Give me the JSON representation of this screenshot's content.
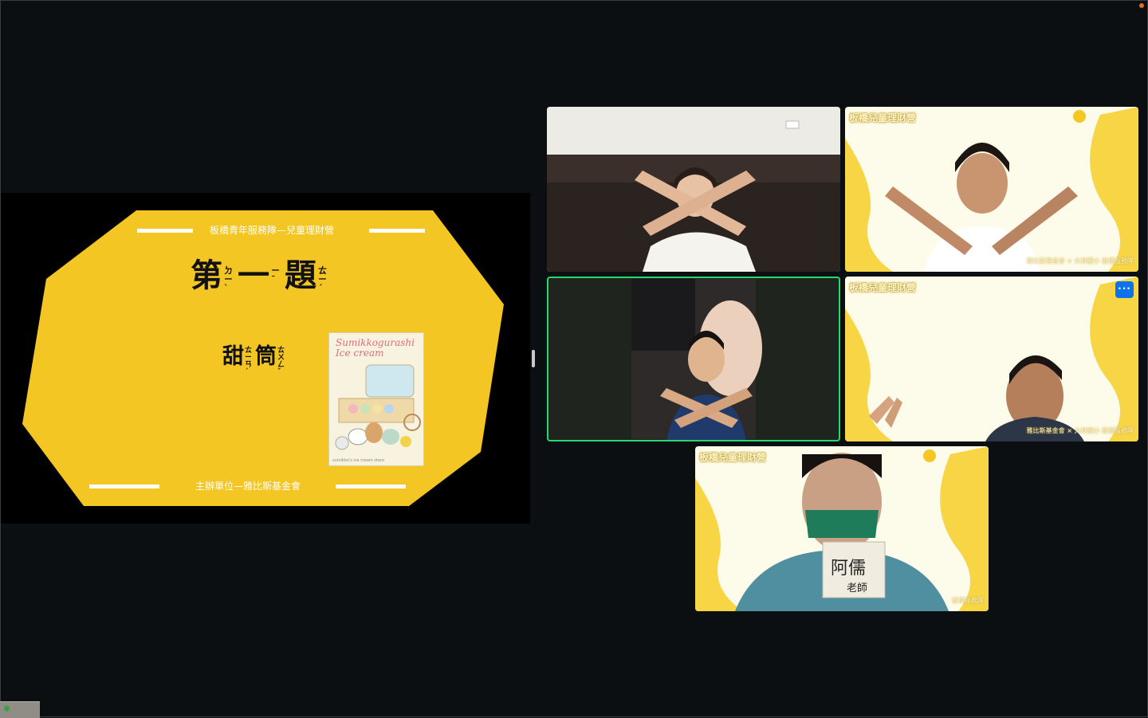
{
  "slide": {
    "header": "板橋青年服務隊—兒童理財營",
    "title_chars": [
      "第",
      "一",
      "題"
    ],
    "title_zhuyin": [
      [
        "ㄉ",
        "ㄧ",
        "ˋ"
      ],
      [
        "ㄧ",
        "ˉ"
      ],
      [
        "ㄊ",
        "ㄧ",
        "ˊ"
      ]
    ],
    "answer_chars": [
      "甜",
      "筒"
    ],
    "answer_zhuyin": [
      [
        "ㄊ",
        "ㄧ",
        "ㄢ",
        "ˊ"
      ],
      [
        "ㄊ",
        "ㄨ",
        "ㄥ",
        "ˇ"
      ]
    ],
    "footer": "主辦單位—雅比斯基金會",
    "poster": {
      "title_line1": "Sumikkogurashi",
      "title_line2": "Ice cream",
      "footer": "sumikko's ice cream store"
    },
    "colors": {
      "slide_yellow": "#f4c623",
      "background": "#000000"
    }
  },
  "video_tiles": [
    {
      "name": "participant-1",
      "brand": "",
      "credit": ""
    },
    {
      "name": "participant-2",
      "brand": "板橋兒童理財營",
      "credit": "雅比斯基金會 × 大林國小 板橋服務隊"
    },
    {
      "name": "participant-3-active-speaker",
      "brand": "",
      "credit": "",
      "active": true
    },
    {
      "name": "participant-4",
      "brand": "板橋兒童理財營",
      "credit": "雅比斯基金會 × 大林國小 板橋服務隊",
      "more_label": "···"
    },
    {
      "name": "participant-5",
      "brand": "板橋兒童理財營",
      "credit": "板橋服務隊",
      "name_tag": "阿儒 老師"
    }
  ],
  "colors": {
    "active_speaker_border": "#23d96b",
    "more_button": "#0e72ed",
    "app_background": "#0c0f12"
  },
  "taskbar": {
    "icon": "app-icon"
  }
}
